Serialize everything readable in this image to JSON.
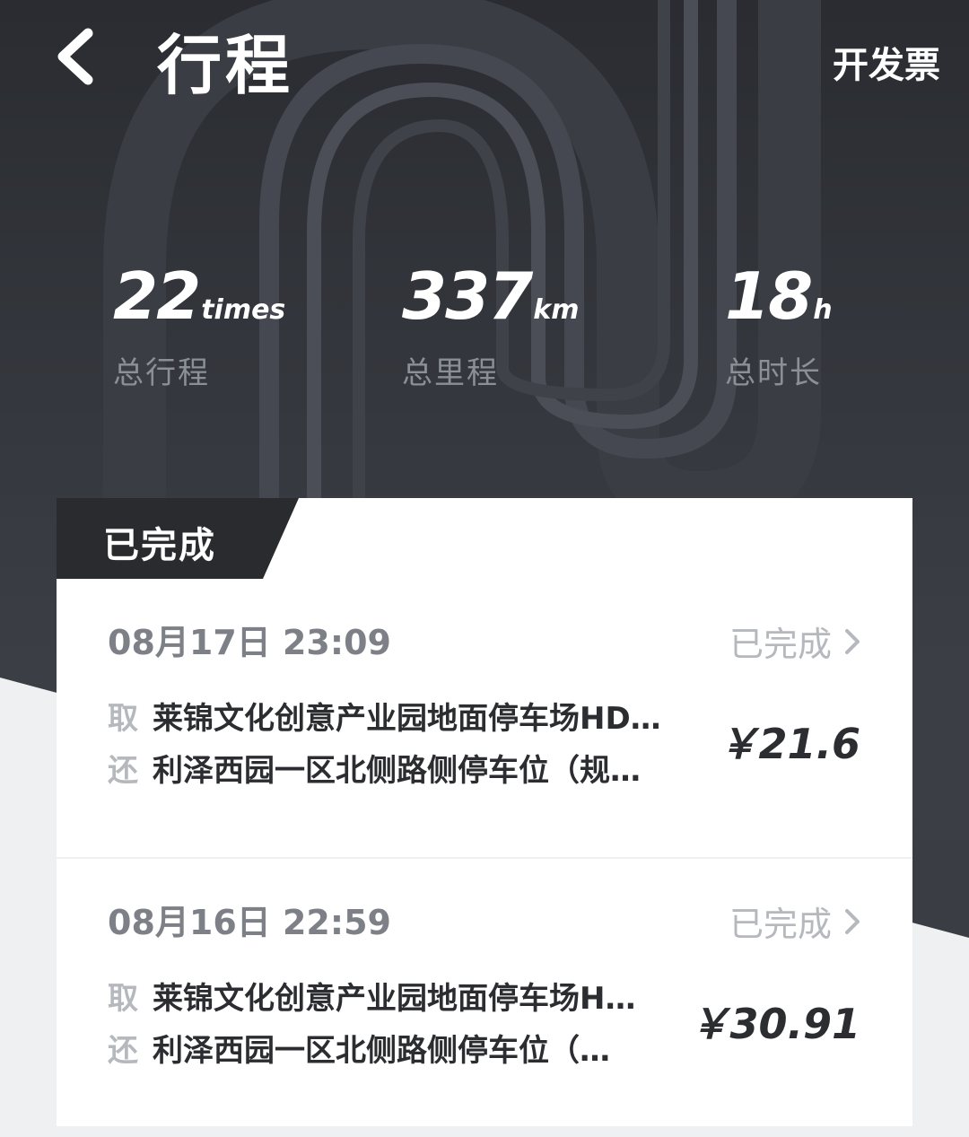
{
  "header": {
    "title": "行程",
    "invoice_label": "开发票"
  },
  "stats": [
    {
      "value": "22",
      "unit": "times",
      "label": "总行程"
    },
    {
      "value": "337",
      "unit": "km",
      "label": "总里程"
    },
    {
      "value": "18",
      "unit": "h",
      "label": "总时长"
    }
  ],
  "section": {
    "label": "已完成"
  },
  "trips": [
    {
      "datetime": "08月17日 23:09",
      "status": "已完成",
      "pickup_tag": "取",
      "pickup": "莱锦文化创意产业园地面停车场HD…",
      "return_tag": "还",
      "return": "利泽西园一区北侧路侧停车位（规…",
      "price": "￥21.6"
    },
    {
      "datetime": "08月16日 22:59",
      "status": "已完成",
      "pickup_tag": "取",
      "pickup": "莱锦文化创意产业园地面停车场H…",
      "return_tag": "还",
      "return": "利泽西园一区北侧路侧停车位（…",
      "price": "￥30.91"
    }
  ],
  "colors": {
    "hero_dark": "#2a2c31",
    "tab_dark": "#2a2b2f",
    "muted_text": "#b5b8bd",
    "date_text": "#7d8087",
    "body_text": "#2b2d31",
    "page_bg": "#eef0f2"
  },
  "icons": {
    "back": "chevron-left-icon",
    "status_arrow": "chevron-right-icon",
    "hero_decoration": "track-loop-graphic"
  }
}
